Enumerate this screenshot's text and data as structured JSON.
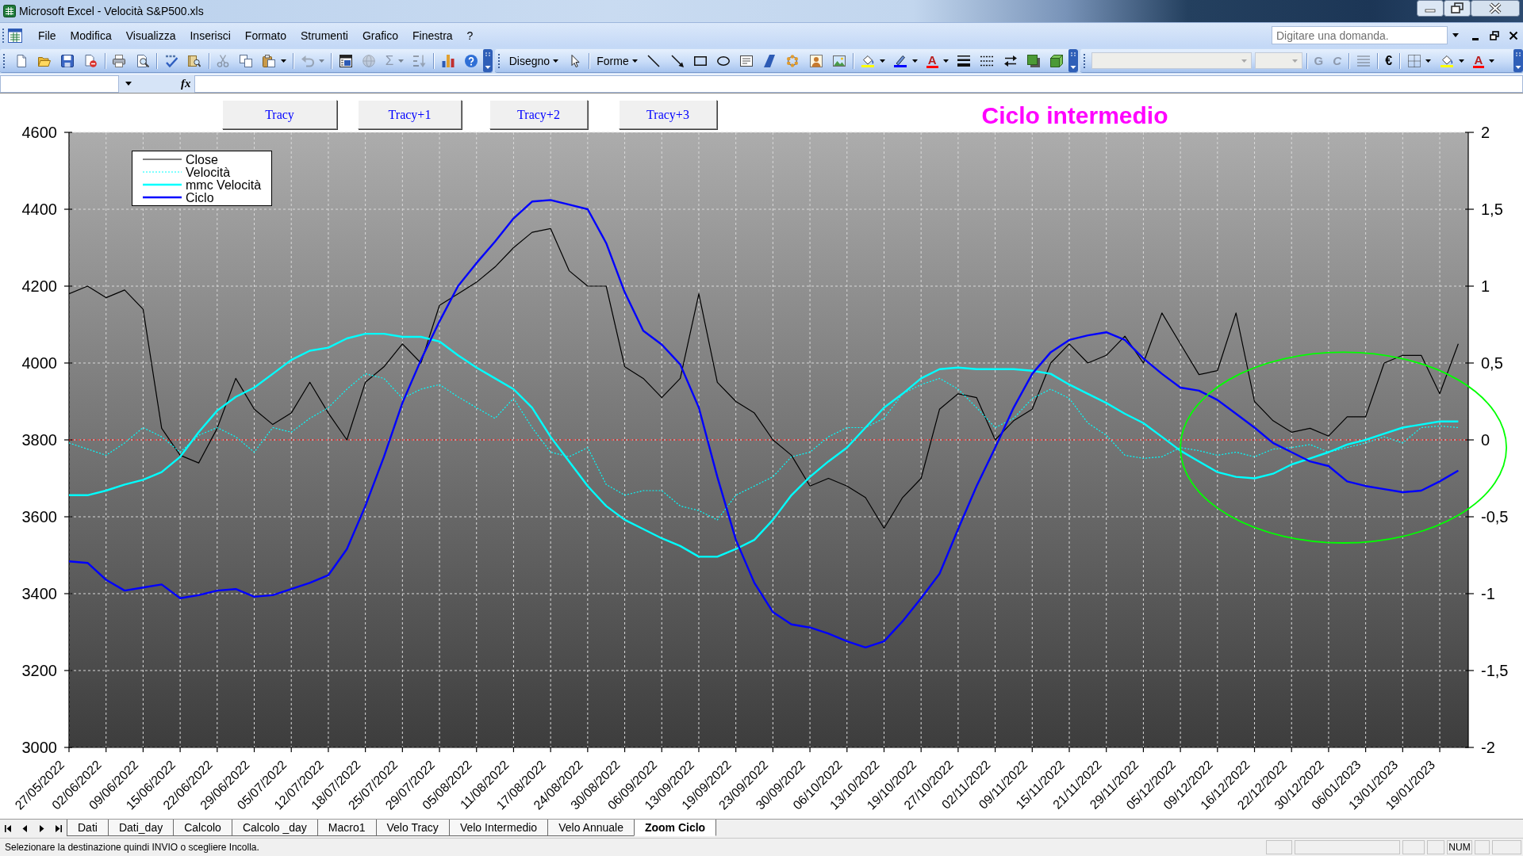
{
  "window": {
    "title": "Microsoft Excel - Velocità S&P500.xls"
  },
  "menu_bar": {
    "items": [
      "File",
      "Modifica",
      "Visualizza",
      "Inserisci",
      "Formato",
      "Strumenti",
      "Grafico",
      "Finestra",
      "?"
    ],
    "help_field": {
      "placeholder": "Digitare una domanda."
    }
  },
  "toolbars": [
    {
      "groups": [
        [
          {
            "kind": "new",
            "disabled": false
          },
          {
            "kind": "open",
            "disabled": false
          },
          {
            "kind": "save",
            "disabled": false
          },
          {
            "kind": "permission",
            "disabled": false
          }
        ],
        [
          {
            "kind": "print",
            "disabled": false
          },
          {
            "kind": "preview",
            "disabled": false
          }
        ],
        [
          {
            "kind": "spelling",
            "disabled": false
          },
          {
            "kind": "research",
            "disabled": false
          }
        ],
        [
          {
            "kind": "cut",
            "disabled": true
          },
          {
            "kind": "copy",
            "disabled": false
          },
          {
            "kind": "paste",
            "disabled": false
          },
          {
            "kind": "caret",
            "disabled": false
          }
        ],
        [
          {
            "kind": "undo",
            "disabled": true
          },
          {
            "kind": "caret",
            "disabled": true
          }
        ],
        [
          {
            "kind": "window",
            "disabled": false
          },
          {
            "kind": "globe",
            "disabled": true
          },
          {
            "kind": "sum",
            "label": "Σ",
            "disabled": true
          },
          {
            "kind": "caret",
            "disabled": true
          },
          {
            "kind": "sort",
            "disabled": true
          }
        ],
        [
          {
            "kind": "chart",
            "disabled": false
          },
          {
            "kind": "help",
            "disabled": false
          }
        ]
      ]
    },
    {
      "groups": [
        [
          {
            "kind": "menu",
            "label": "Disegno",
            "disabled": false
          },
          {
            "kind": "pointer",
            "disabled": false
          }
        ],
        [
          {
            "kind": "menu",
            "label": "Forme",
            "disabled": false
          },
          {
            "kind": "line",
            "disabled": false
          },
          {
            "kind": "arrow",
            "disabled": false
          },
          {
            "kind": "rect",
            "disabled": false
          },
          {
            "kind": "oval",
            "disabled": false
          },
          {
            "kind": "textbox",
            "disabled": false
          },
          {
            "kind": "wordart",
            "disabled": false
          },
          {
            "kind": "diagram",
            "disabled": false
          },
          {
            "kind": "clipart",
            "disabled": false
          },
          {
            "kind": "picture",
            "disabled": false
          }
        ],
        [
          {
            "kind": "fill",
            "disabled": false
          },
          {
            "kind": "caret",
            "disabled": false
          },
          {
            "kind": "pen",
            "disabled": false
          },
          {
            "kind": "caret",
            "disabled": false
          },
          {
            "kind": "fontcolor",
            "label": "A",
            "disabled": false
          },
          {
            "kind": "caret",
            "disabled": false
          },
          {
            "kind": "weights",
            "disabled": false
          },
          {
            "kind": "dashes",
            "disabled": false
          },
          {
            "kind": "arrows",
            "disabled": false
          },
          {
            "kind": "shadow",
            "disabled": false
          },
          {
            "kind": "cube",
            "disabled": false
          }
        ]
      ]
    },
    {
      "groups": [
        [
          {
            "kind": "fontbox",
            "disabled": true
          },
          {
            "kind": "sizebox",
            "disabled": true
          }
        ],
        [
          {
            "kind": "bold",
            "label": "G",
            "disabled": true
          },
          {
            "kind": "italic",
            "label": "C",
            "disabled": true
          }
        ],
        [
          {
            "kind": "justify",
            "disabled": true
          }
        ],
        [
          {
            "kind": "euro",
            "label": "€",
            "disabled": false
          }
        ],
        [
          {
            "kind": "borders",
            "disabled": false
          },
          {
            "kind": "caret",
            "disabled": false
          },
          {
            "kind": "fill",
            "disabled": false
          },
          {
            "kind": "caret",
            "disabled": false
          },
          {
            "kind": "fontcolor",
            "label": "A",
            "disabled": false
          },
          {
            "kind": "caret",
            "disabled": false
          }
        ]
      ]
    }
  ],
  "formula_bar": {
    "function_symbol": "fx"
  },
  "chart": {
    "buttons": [
      "Tracy",
      "Tracy+1",
      "Tracy+2",
      "Tracy+3"
    ],
    "chart_data": {
      "type": "line",
      "title": "Ciclo intermedio",
      "categories": [
        "27/05/2022",
        null,
        "02/06/2022",
        null,
        "09/06/2022",
        null,
        "15/06/2022",
        null,
        "22/06/2022",
        null,
        "29/06/2022",
        null,
        "05/07/2022",
        null,
        "12/07/2022",
        null,
        "18/07/2022",
        null,
        "25/07/2022",
        null,
        "29/07/2022",
        null,
        "05/08/2022",
        null,
        "11/08/2022",
        null,
        "17/08/2022",
        null,
        "24/08/2022",
        null,
        "30/08/2022",
        null,
        "06/09/2022",
        null,
        "13/09/2022",
        null,
        "19/09/2022",
        null,
        "23/09/2022",
        null,
        "30/09/2022",
        null,
        "06/10/2022",
        null,
        "13/10/2022",
        null,
        "19/10/2022",
        null,
        "27/10/2022",
        null,
        "02/11/2022",
        null,
        "09/11/2022",
        null,
        "15/11/2022",
        null,
        "21/11/2022",
        null,
        "29/11/2022",
        null,
        "05/12/2022",
        null,
        "09/12/2022",
        null,
        "16/12/2022",
        null,
        "22/12/2022",
        null,
        "30/12/2022",
        null,
        "06/01/2023",
        null,
        "13/01/2023",
        null,
        "19/01/2023",
        null
      ],
      "ylim": [
        3000,
        4600
      ],
      "y2lim": [
        -2,
        2
      ],
      "yticks": [
        3000,
        3200,
        3400,
        3600,
        3800,
        4000,
        4200,
        4400,
        4600
      ],
      "y2ticks": [
        -2,
        {
          "value": -1.5,
          "label": "-1,5"
        },
        -1,
        {
          "value": -0.5,
          "label": "-0,5"
        },
        0,
        {
          "value": 0.5,
          "label": "0,5"
        },
        1,
        {
          "value": 1.5,
          "label": "1,5"
        },
        2
      ],
      "grid": true,
      "legend": "upper left",
      "series": [
        {
          "name": "Close",
          "color": "#000000",
          "line_style": "solid",
          "values": [
            4180,
            4200,
            4170,
            4190,
            4140,
            3830,
            3760,
            3740,
            3830,
            3960,
            3880,
            3840,
            3870,
            3950,
            3870,
            3800,
            3950,
            3990,
            4050,
            4000,
            4150,
            4180,
            4210,
            4250,
            4300,
            4340,
            4350,
            4240,
            4200,
            4200,
            3990,
            3960,
            3910,
            3960,
            4180,
            3950,
            3900,
            3870,
            3800,
            3760,
            3680,
            3700,
            3680,
            3650,
            3570,
            3650,
            3700,
            3880,
            3920,
            3910,
            3800,
            3850,
            3880,
            4000,
            4050,
            4000,
            4020,
            4070,
            4000,
            4130,
            4050,
            3970,
            3980,
            4130,
            3900,
            3850,
            3820,
            3830,
            3810,
            3860,
            3860,
            4000,
            4020,
            4020,
            3920,
            4050
          ]
        },
        {
          "name": "Velocità",
          "color": "#00ffff",
          "axis": "y2",
          "line_style": "dotted",
          "values": [
            -0.02,
            -0.06,
            -0.1,
            -0.02,
            0.08,
            0.02,
            -0.08,
            0.03,
            0.08,
            0.02,
            -0.08,
            0.08,
            0.05,
            0.14,
            0.21,
            0.33,
            0.43,
            0.4,
            0.27,
            0.33,
            0.36,
            0.28,
            0.21,
            0.14,
            0.27,
            0.08,
            -0.08,
            -0.11,
            -0.05,
            -0.29,
            -0.36,
            -0.33,
            -0.33,
            -0.43,
            -0.46,
            -0.52,
            -0.36,
            -0.3,
            -0.24,
            -0.11,
            -0.08,
            0.02,
            0.08,
            0.08,
            0.14,
            0.3,
            0.36,
            0.4,
            0.33,
            0.21,
            0.08,
            0.14,
            0.27,
            0.33,
            0.27,
            0.11,
            0.03,
            -0.1,
            -0.12,
            -0.11,
            -0.05,
            -0.07,
            -0.1,
            -0.08,
            -0.11,
            -0.06,
            -0.05,
            -0.03,
            -0.08,
            -0.05,
            -0.02,
            0.02,
            -0.02,
            0.08,
            0.09,
            0.08
          ]
        },
        {
          "name": "mmc Velocità",
          "color": "#00ffff",
          "axis": "y2",
          "line_style": "solid",
          "values": [
            -0.36,
            -0.36,
            -0.33,
            -0.29,
            -0.26,
            -0.21,
            -0.11,
            0.05,
            0.19,
            0.28,
            0.34,
            0.43,
            0.52,
            0.58,
            0.6,
            0.66,
            0.69,
            0.69,
            0.67,
            0.67,
            0.64,
            0.55,
            0.47,
            0.4,
            0.33,
            0.21,
            0.02,
            -0.14,
            -0.3,
            -0.43,
            -0.52,
            -0.58,
            -0.64,
            -0.69,
            -0.76,
            -0.76,
            -0.71,
            -0.65,
            -0.52,
            -0.36,
            -0.24,
            -0.14,
            -0.05,
            0.08,
            0.21,
            0.3,
            0.4,
            0.46,
            0.47,
            0.46,
            0.46,
            0.46,
            0.45,
            0.43,
            0.36,
            0.3,
            0.24,
            0.17,
            0.11,
            0.02,
            -0.07,
            -0.14,
            -0.21,
            -0.24,
            -0.25,
            -0.22,
            -0.16,
            -0.12,
            -0.08,
            -0.03,
            0,
            0.04,
            0.08,
            0.1,
            0.12,
            0.12
          ]
        },
        {
          "name": "Ciclo",
          "color": "#0000ff",
          "axis": "y2",
          "line_style": "solid",
          "values": [
            -0.79,
            -0.8,
            -0.91,
            -0.98,
            -0.96,
            -0.94,
            -1.03,
            -1.01,
            -0.98,
            -0.97,
            -1.02,
            -1.01,
            -0.97,
            -0.93,
            -0.88,
            -0.71,
            -0.43,
            -0.11,
            0.24,
            0.52,
            0.77,
            1,
            1.15,
            1.29,
            1.44,
            1.55,
            1.56,
            1.53,
            1.5,
            1.28,
            0.96,
            0.71,
            0.62,
            0.49,
            0.21,
            -0.24,
            -0.65,
            -0.93,
            -1.12,
            -1.2,
            -1.22,
            -1.26,
            -1.31,
            -1.35,
            -1.31,
            -1.18,
            -1.03,
            -0.87,
            -0.58,
            -0.3,
            -0.05,
            0.21,
            0.43,
            0.57,
            0.65,
            0.68,
            0.7,
            0.65,
            0.53,
            0.43,
            0.34,
            0.32,
            0.26,
            0.17,
            0.08,
            -0.02,
            -0.08,
            -0.14,
            -0.17,
            -0.27,
            -0.3,
            -0.32,
            -0.34,
            -0.33,
            -0.27,
            -0.2
          ]
        }
      ],
      "ref_lines": [
        {
          "axis": "y2",
          "value": 0
        }
      ]
    }
  },
  "sheet_tabs": [
    {
      "label": "Dati",
      "selected": false
    },
    {
      "label": "Dati_day",
      "selected": false
    },
    {
      "label": "Calcolo",
      "selected": false
    },
    {
      "label": "Calcolo _day",
      "selected": false
    },
    {
      "label": "Macro1",
      "selected": false
    },
    {
      "label": "Velo Tracy",
      "selected": false
    },
    {
      "label": "Velo Intermedio",
      "selected": false
    },
    {
      "label": "Velo Annuale",
      "selected": false
    },
    {
      "label": "Zoom Ciclo",
      "selected": true
    }
  ],
  "status_bar": {
    "message": "Selezionare la destinazione quindi INVIO o scegliere Incolla.",
    "indicators": [
      "NUM"
    ]
  }
}
